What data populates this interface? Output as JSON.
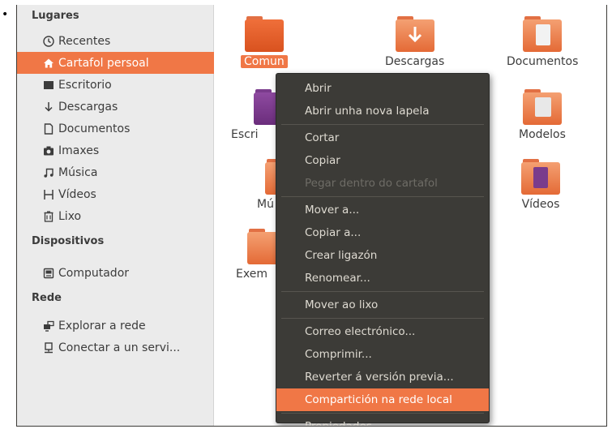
{
  "sidebar": {
    "places_title": "Lugares",
    "places": [
      {
        "label": "Recentes",
        "icon": "clock-icon"
      },
      {
        "label": "Cartafol persoal",
        "icon": "home-icon",
        "selected": true
      },
      {
        "label": "Escritorio",
        "icon": "desktop-icon"
      },
      {
        "label": "Descargas",
        "icon": "download-icon"
      },
      {
        "label": "Documentos",
        "icon": "document-icon"
      },
      {
        "label": "Imaxes",
        "icon": "camera-icon"
      },
      {
        "label": "Música",
        "icon": "music-icon"
      },
      {
        "label": "Vídeos",
        "icon": "film-icon"
      },
      {
        "label": "Lixo",
        "icon": "trash-icon"
      }
    ],
    "devices_title": "Dispositivos",
    "devices": [
      {
        "label": "Computador",
        "icon": "computer-icon"
      }
    ],
    "network_title": "Rede",
    "network": [
      {
        "label": "Explorar a rede",
        "icon": "network-icon"
      },
      {
        "label": "Conectar a un servi...",
        "icon": "server-icon"
      }
    ]
  },
  "folders": {
    "comun": "Comun",
    "descargas": "Descargas",
    "documentos": "Documentos",
    "escritorio": "Escri",
    "modelos": "Modelos",
    "musica": "Mú",
    "videos": "Vídeos",
    "exemplos": "Exem"
  },
  "context_menu": {
    "items": [
      {
        "label": "Abrir"
      },
      {
        "label": "Abrir unha nova lapela"
      },
      {
        "sep": true
      },
      {
        "label": "Cortar"
      },
      {
        "label": "Copiar"
      },
      {
        "label": "Pegar dentro do cartafol",
        "disabled": true
      },
      {
        "sep": true
      },
      {
        "label": "Mover a..."
      },
      {
        "label": "Copiar a..."
      },
      {
        "label": "Crear ligazón"
      },
      {
        "label": "Renomear..."
      },
      {
        "sep": true
      },
      {
        "label": "Mover ao lixo"
      },
      {
        "sep": true
      },
      {
        "label": "Correo electrónico..."
      },
      {
        "label": "Comprimir..."
      },
      {
        "label": "Reverter á versión previa..."
      },
      {
        "label": "Compartición na rede local",
        "highlighted": true
      },
      {
        "sep": true
      },
      {
        "label": "Propiedades"
      }
    ]
  },
  "colors": {
    "accent": "#f07746",
    "menu_bg": "#3c3b37",
    "sidebar_bg": "#ebebeb"
  }
}
